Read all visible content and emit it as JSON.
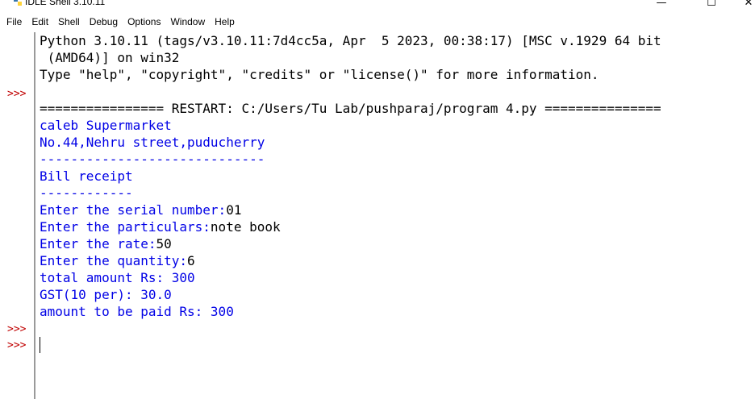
{
  "window": {
    "title": "IDLE Shell 3.10.11",
    "controls": {
      "minimize": "—",
      "maximize": "☐",
      "close": "✕"
    }
  },
  "menubar": {
    "items": [
      "File",
      "Edit",
      "Shell",
      "Debug",
      "Options",
      "Window",
      "Help"
    ]
  },
  "gutter": {
    "prompts": [
      ">>>",
      ">>>",
      ">>>"
    ]
  },
  "shell": {
    "banner_line1": "Python 3.10.11 (tags/v3.10.11:7d4cc5a, Apr  5 2023, 00:38:17) [MSC v.1929 64 bit",
    "banner_line2": " (AMD64)] on win32",
    "banner_line3": "Type \"help\", \"copyright\", \"credits\" or \"license()\" for more information.",
    "restart_line": "================ RESTART: C:/Users/Tu Lab/pushparaj/program 4.py ===============",
    "output": {
      "store_name": "caleb Supermarket",
      "address": "No.44,Nehru street,puducherry",
      "separator1": "-----------------------------",
      "heading": "Bill receipt",
      "separator2": "------------",
      "prompt_serial": "Enter the serial number:",
      "input_serial": "01",
      "prompt_particulars": "Enter the particulars:",
      "input_particulars": "note book",
      "prompt_rate": "Enter the rate:",
      "input_rate": "50",
      "prompt_quantity": "Enter the quantity:",
      "input_quantity": "6",
      "total_line": "total amount Rs: 300",
      "gst_line": "GST(10 per): 30.0",
      "amount_line": "amount to be paid Rs: 300"
    }
  },
  "colors": {
    "output_text": "#0000e6",
    "prompt": "#c00000",
    "plain_text": "#000000"
  }
}
